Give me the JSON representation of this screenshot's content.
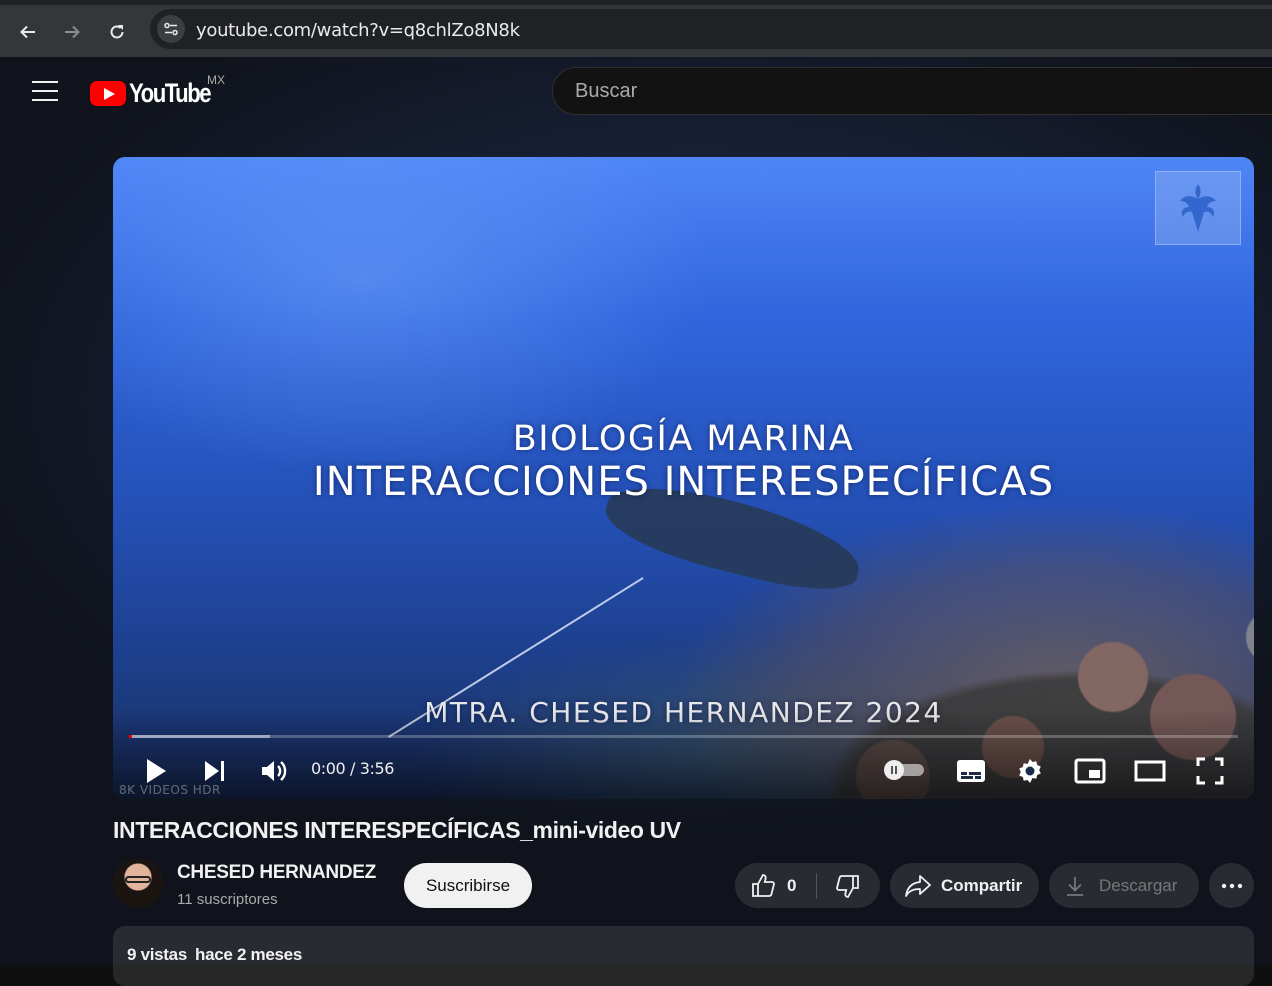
{
  "browser": {
    "url": "youtube.com/watch?v=q8chlZo8N8k",
    "icons": [
      "back-arrow-icon",
      "forward-arrow-icon",
      "reload-icon",
      "site-info-icon"
    ]
  },
  "header": {
    "logo_text": "YouTube",
    "region": "MX",
    "search_placeholder": "Buscar",
    "brand_color": "#ff0000"
  },
  "player": {
    "overlay": {
      "line1": "BIOLOGÍA MARINA",
      "line2": "INTERACCIONES INTERESPECÍFICAS",
      "credit": "MTRA. CHESED HERNANDEZ 2024",
      "corner_mark": "8K VIDEOS HDR"
    },
    "time": "0:00 / 3:56",
    "buffered_fraction": 0.127,
    "played_fraction": 0.0,
    "icons": [
      "play-icon",
      "next-icon",
      "volume-icon",
      "autoplay-toggle",
      "subtitles-icon",
      "settings-gear-icon",
      "miniplayer-icon",
      "theater-mode-icon",
      "fullscreen-icon"
    ]
  },
  "video": {
    "title": "INTERACCIONES INTERESPECÍFICAS_mini-video UV",
    "channel_name": "CHESED HERNANDEZ",
    "subscribers": "11 suscriptores",
    "subscribe_label": "Suscribirse",
    "likes": "0",
    "share_label": "Compartir",
    "download_label": "Descargar",
    "views": "9 vistas",
    "date": "hace 2 meses"
  }
}
